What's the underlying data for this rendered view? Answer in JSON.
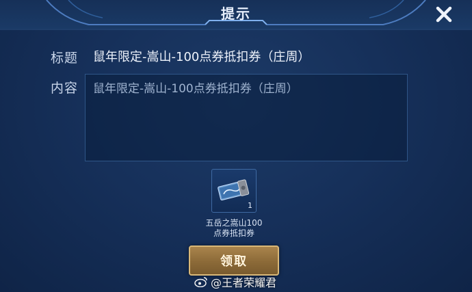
{
  "dialog": {
    "title": "提示",
    "close_icon": "close-icon"
  },
  "form": {
    "title_label": "标题",
    "title_value": "鼠年限定-嵩山-100点券抵扣券（庄周）",
    "content_label": "内容",
    "content_value": "鼠年限定-嵩山-100点券抵扣券（庄周）"
  },
  "reward": {
    "icon": "coupon-icon",
    "count": "1",
    "name": "五岳之嵩山100点券抵扣券"
  },
  "actions": {
    "claim_label": "领取"
  },
  "watermark": {
    "text": "@王者荣耀君",
    "icon": "weibo-icon"
  },
  "colors": {
    "background": "#16305a",
    "accent_gold": "#d9b878",
    "border_blue": "#2f5688"
  }
}
